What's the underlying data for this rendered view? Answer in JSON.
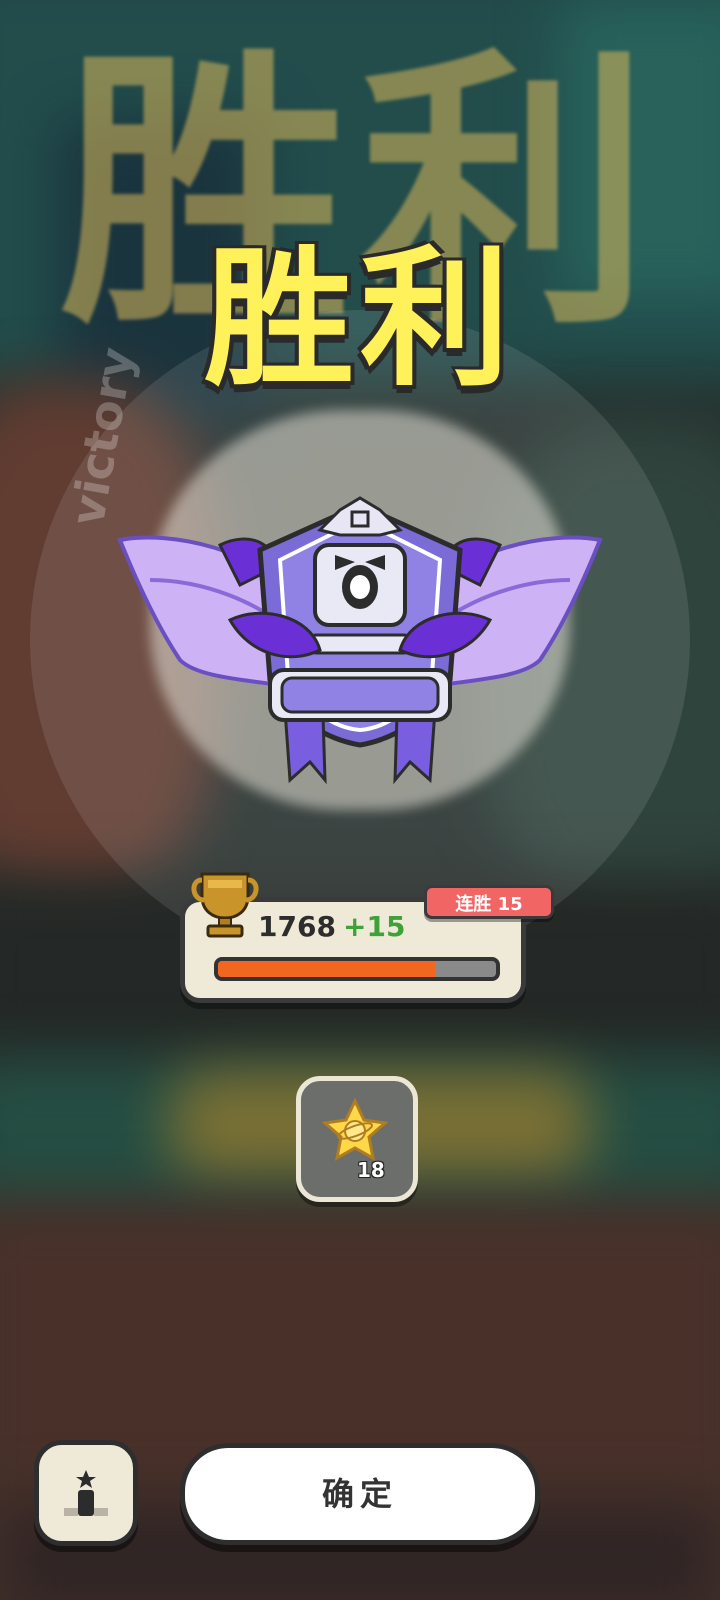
{
  "result": {
    "title": "胜利",
    "ring_text": "victory"
  },
  "rank": {
    "score": "1768",
    "delta": "+15",
    "streak_label": "连胜 15",
    "progress": 0.78
  },
  "reward": {
    "icon": "planet-star-icon",
    "count": "18"
  },
  "buttons": {
    "confirm_label": "确定",
    "rank_icon": "podium-icon"
  },
  "colors": {
    "title": "#fff159",
    "streak": "#f16565",
    "delta": "#3ea13a",
    "progress": "#f1671f"
  }
}
